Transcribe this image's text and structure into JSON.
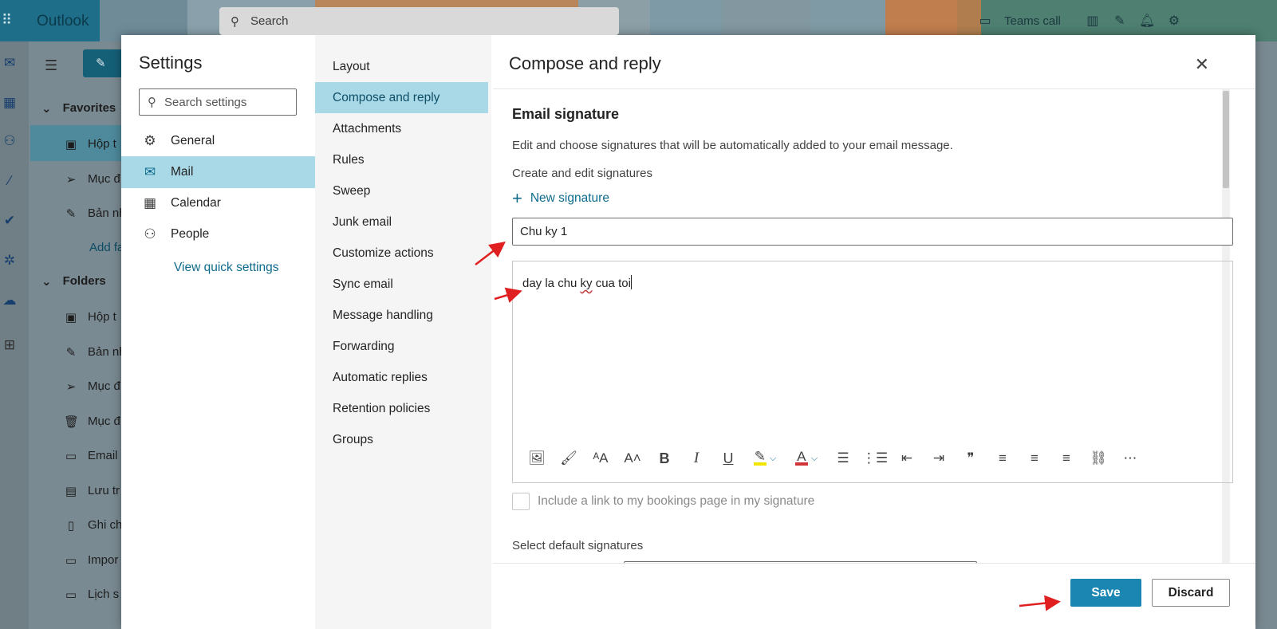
{
  "app": {
    "title": "Outlook",
    "search_placeholder": "Search",
    "teams_call": "Teams call"
  },
  "folder_pane": {
    "favorites": "Favorites",
    "fav_items": [
      "Hộp t",
      "Mục đ",
      "Bản nh"
    ],
    "add_favorite": "Add fa",
    "folders": "Folders",
    "folder_items": [
      "Hộp t",
      "Bản nh",
      "Mục đ",
      "Mục đ",
      "Email",
      "Lưu tr",
      "Ghi ch",
      "Impor",
      "Lịch s"
    ]
  },
  "settings": {
    "title": "Settings",
    "search_placeholder": "Search settings",
    "categories": [
      {
        "label": "General",
        "icon": "gear-icon"
      },
      {
        "label": "Mail",
        "icon": "mail-icon"
      },
      {
        "label": "Calendar",
        "icon": "calendar-icon"
      },
      {
        "label": "People",
        "icon": "people-icon"
      }
    ],
    "selected_category": "Mail",
    "quick_settings": "View quick settings",
    "mail_sections": [
      "Layout",
      "Compose and reply",
      "Attachments",
      "Rules",
      "Sweep",
      "Junk email",
      "Customize actions",
      "Sync email",
      "Message handling",
      "Forwarding",
      "Automatic replies",
      "Retention policies",
      "Groups"
    ],
    "selected_section": "Compose and reply"
  },
  "content": {
    "title": "Compose and reply",
    "section_title": "Email signature",
    "description": "Edit and choose signatures that will be automatically added to your email message.",
    "create_edit": "Create and edit signatures",
    "new_signature": "New signature",
    "signature_name": "Chu ky 1",
    "signature_body_pre": "day la chu ",
    "signature_body_flag": "ky",
    "signature_body_post": " cua toi",
    "bookings_checkbox": "Include a link to my bookings page in my signature",
    "bookings_checked": false,
    "select_default": "Select default signatures",
    "save": "Save",
    "discard": "Discard"
  },
  "colors": {
    "accent": "#1b86b1",
    "selected_bg": "#a9d8e6",
    "annotation_red": "#e02020"
  }
}
